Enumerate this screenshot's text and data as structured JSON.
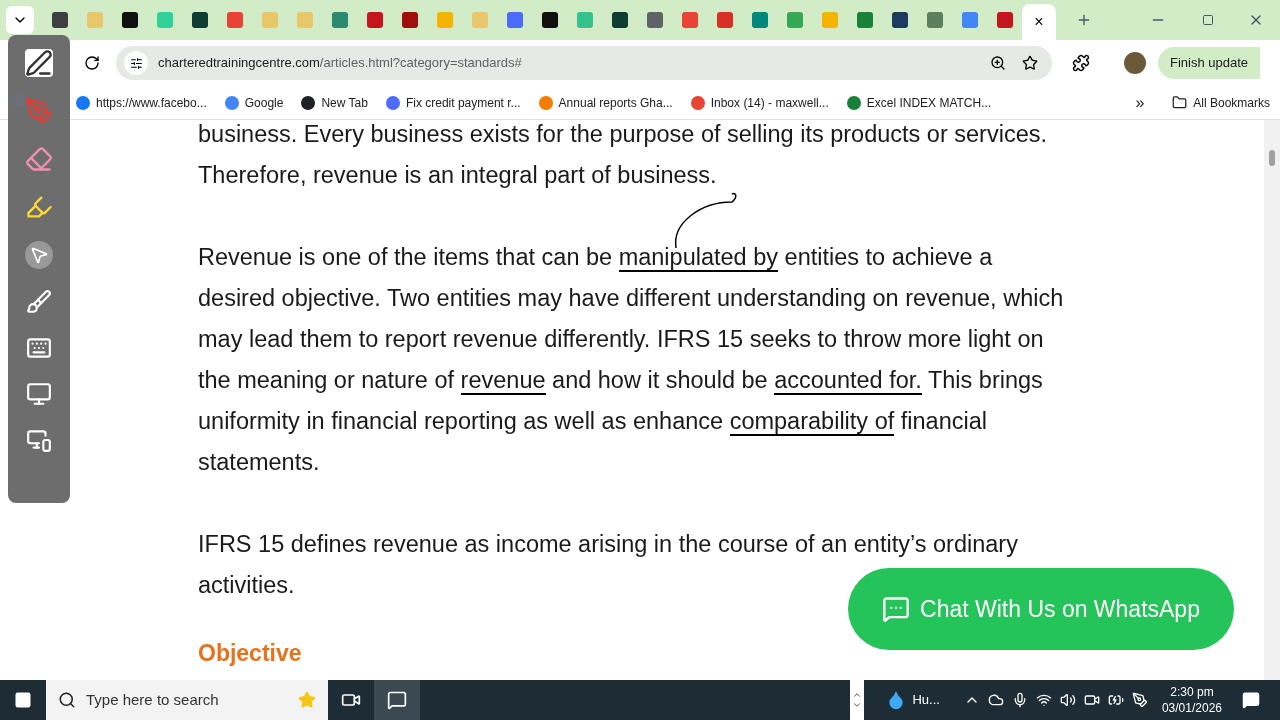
{
  "tabs": [
    {
      "color": "#3c4043",
      "selected": false
    },
    {
      "color": "#e8c66a",
      "selected": false
    },
    {
      "color": "#111111",
      "selected": false
    },
    {
      "color": "#2fd39a",
      "selected": false
    },
    {
      "color": "#0f3d33",
      "selected": false
    },
    {
      "color": "#ea4335",
      "selected": false
    },
    {
      "color": "#e8c66a",
      "selected": false
    },
    {
      "color": "#e8c66a",
      "selected": false
    },
    {
      "color": "#2b8a6f",
      "selected": false
    },
    {
      "color": "#c4161c",
      "selected": false
    },
    {
      "color": "#a10f0f",
      "selected": false
    },
    {
      "color": "#f4b400",
      "selected": false
    },
    {
      "color": "#e8c66a",
      "selected": false
    },
    {
      "color": "#4d6bfe",
      "selected": false
    },
    {
      "color": "#111111",
      "selected": false
    },
    {
      "color": "#36c28f",
      "selected": false
    },
    {
      "color": "#0f3d33",
      "selected": false
    },
    {
      "color": "#5f6368",
      "selected": false
    },
    {
      "color": "#ea4335",
      "selected": false
    },
    {
      "color": "#d93025",
      "selected": false
    },
    {
      "color": "#00897b",
      "selected": false
    },
    {
      "color": "#34a853",
      "selected": false
    },
    {
      "color": "#f4b400",
      "selected": false
    },
    {
      "color": "#188038",
      "selected": false
    },
    {
      "color": "#1f3a5f",
      "selected": false
    },
    {
      "color": "#5b7f5b",
      "selected": false
    },
    {
      "color": "#4285f4",
      "selected": false
    },
    {
      "color": "#c4161c",
      "selected": false
    },
    {
      "color": "#ffffff",
      "selected": true,
      "close": "×"
    }
  ],
  "address": {
    "domain": "charteredtrainingcentre.com",
    "path": "/articles.html?category=standards#"
  },
  "update_button": "Finish update",
  "bookmarks": [
    {
      "label": "https://www.facebo...",
      "color": "#1877f2"
    },
    {
      "label": "Google",
      "color": "#4285f4"
    },
    {
      "label": "New Tab",
      "color": "#202124"
    },
    {
      "label": "Fix credit payment r...",
      "color": "#4d6bfe"
    },
    {
      "label": "Annual reports Gha...",
      "color": "#f57c00"
    },
    {
      "label": "Inbox (14) - maxwell...",
      "color": "#ea4335"
    },
    {
      "label": "Excel INDEX MATCH...",
      "color": "#188038"
    }
  ],
  "overflow": "»",
  "all_bookmarks": "All Bookmarks",
  "paragraphs": [
    [
      {
        "text": "business. Every business exists for the purpose of selling its products or services. Therefore, revenue is an integral part of business.",
        "underlined": false
      }
    ],
    [
      {
        "text": "Revenue is one of the items that can be ",
        "underlined": false
      },
      {
        "text": "manipulated by",
        "underlined": true
      },
      {
        "text": " entities to achieve a desired objective. Two entities may have different understanding on revenue, which may lead them to report revenue differently. IFRS 15 seeks to throw more light on the meaning or nature of ",
        "underlined": false
      },
      {
        "text": "revenue",
        "underlined": true
      },
      {
        "text": " and how it should be ",
        "underlined": false
      },
      {
        "text": "accounted for.",
        "underlined": true
      },
      {
        "text": " This brings uniformity in financial reporting as well as enhance ",
        "underlined": false
      },
      {
        "text": "comparability of",
        "underlined": true
      },
      {
        "text": " financial statements.",
        "underlined": false
      }
    ],
    [
      {
        "text": "IFRS 15 defines revenue as income arising in the course of an entity’s ordinary activities.",
        "underlined": false
      }
    ]
  ],
  "heading": "Objective",
  "whatsapp": "Chat With Us on WhatsApp",
  "taskbar": {
    "search_placeholder": "Type here to search",
    "weather": "Hu...",
    "time": "2:30 pm",
    "date": "03/01/2026"
  }
}
